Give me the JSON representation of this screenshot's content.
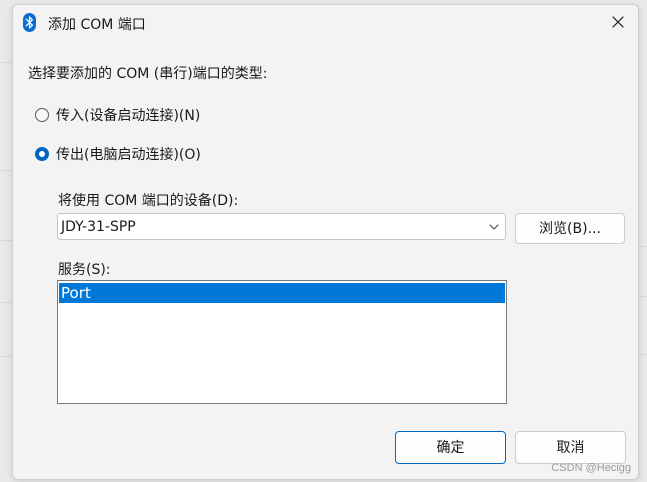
{
  "dialog": {
    "title": "添加 COM 端口",
    "title_icon": "bluetooth-icon",
    "close_icon": "close-icon"
  },
  "port_type": {
    "label": "选择要添加的 COM (串行)端口的类型:",
    "options": [
      {
        "label": "传入(设备启动连接)(N)",
        "checked": false
      },
      {
        "label": "传出(电脑启动连接)(O)",
        "checked": true
      }
    ]
  },
  "device": {
    "label": "将使用 COM 端口的设备(D):",
    "selected": "JDY-31-SPP",
    "browse_label": "浏览(B)..."
  },
  "service": {
    "label": "服务(S):",
    "items": [
      "Port"
    ],
    "selected_index": 0
  },
  "footer": {
    "ok_label": "确定",
    "cancel_label": "取消"
  },
  "watermark": "CSDN @Hecigg",
  "colors": {
    "accent": "#0067c0",
    "selection": "#0078d7",
    "bluetooth_icon": "#0a6ed1"
  }
}
